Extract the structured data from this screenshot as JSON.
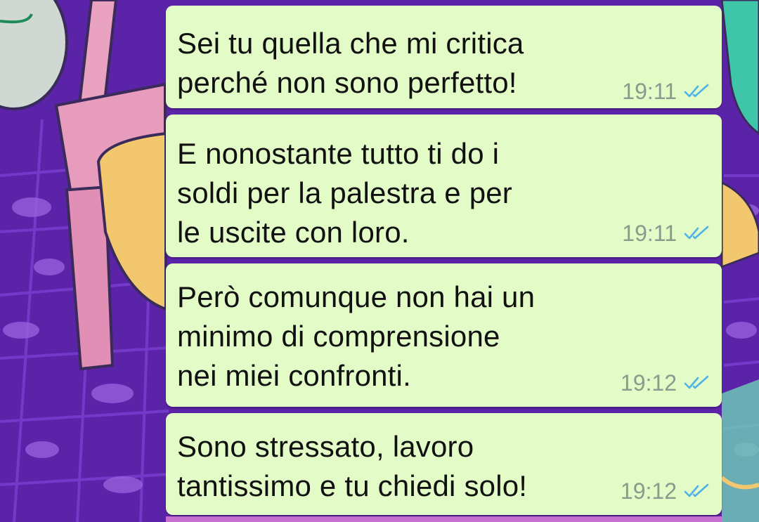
{
  "colors": {
    "bubble_background": "#e2fbc7",
    "message_text": "#111111",
    "timestamp": "#8a9a8c",
    "read_ticks": "#4fb3e8",
    "wallpaper_purple": "#5b23a8"
  },
  "messages": [
    {
      "text": "Sei tu quella che mi critica\nperché non sono perfetto!",
      "time": "19:11",
      "status_icon": "double-check-read-icon"
    },
    {
      "text": "E nonostante tutto ti do i\nsoldi per la palestra e per\nle uscite con loro.",
      "time": "19:11",
      "status_icon": "double-check-read-icon"
    },
    {
      "text": "Però comunque non hai un\nminimo di comprensione\nnei miei confronti.",
      "time": "19:12",
      "status_icon": "double-check-read-icon"
    },
    {
      "text": "Sono stressato, lavoro\ntantissimo e tu chiedi solo!",
      "time": "19:12",
      "status_icon": "double-check-read-icon"
    }
  ]
}
